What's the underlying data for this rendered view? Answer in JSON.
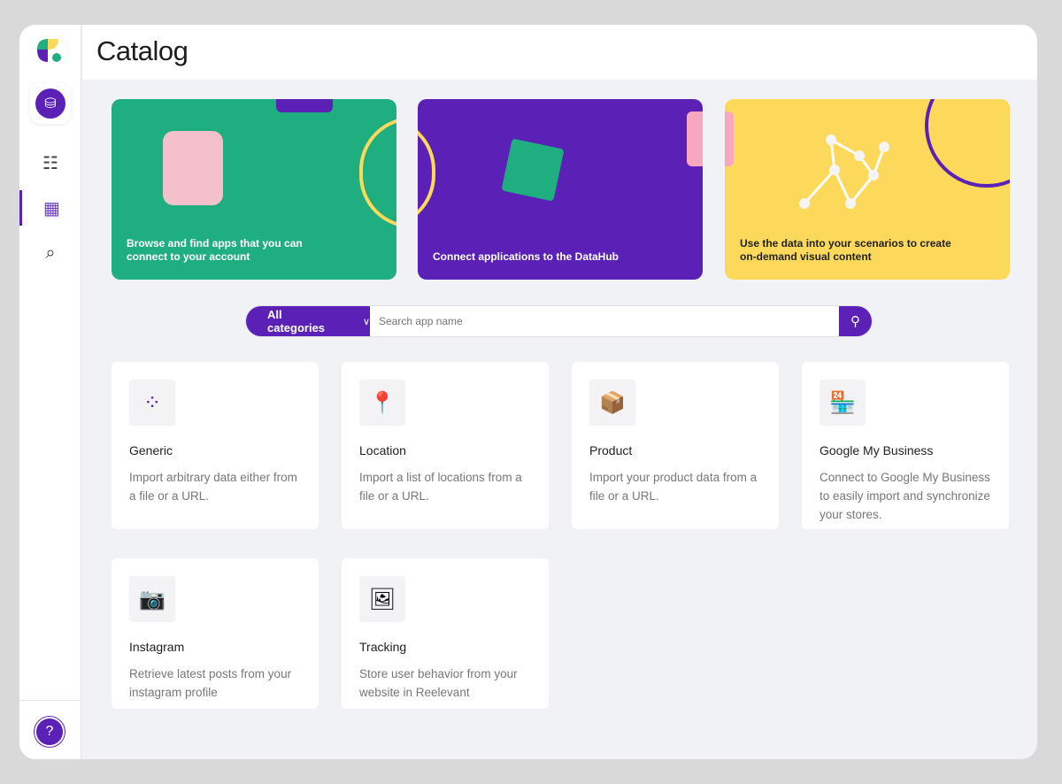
{
  "header": {
    "title": "Catalog"
  },
  "banners": [
    {
      "text": "Browse and find apps that you can connect to your account",
      "color": "#1fae80"
    },
    {
      "text": "Connect applications to the DataHub",
      "color": "#5b21b6"
    },
    {
      "text": "Use the data into your scenarios to create on-demand visual content",
      "color": "#fcd95a"
    }
  ],
  "search": {
    "category": "All categories",
    "placeholder": "Search app name"
  },
  "apps": [
    {
      "name": "Generic",
      "desc": "Import arbitrary data either from a file or a URL.",
      "icon": "⁘"
    },
    {
      "name": "Location",
      "desc": "Import a list of locations from a file or a URL.",
      "icon": "📍"
    },
    {
      "name": "Product",
      "desc": "Import your product data from a file or a URL.",
      "icon": "📦"
    },
    {
      "name": "Google My Business",
      "desc": "Connect to Google My Business to easily import and synchronize your stores.",
      "icon": "🏪"
    },
    {
      "name": "Instagram",
      "desc": "Retrieve latest posts from your instagram profile",
      "icon": "📷"
    },
    {
      "name": "Tracking",
      "desc": "Store user behavior from your website in Reelevant",
      "icon": "🖼"
    }
  ],
  "help": "?"
}
